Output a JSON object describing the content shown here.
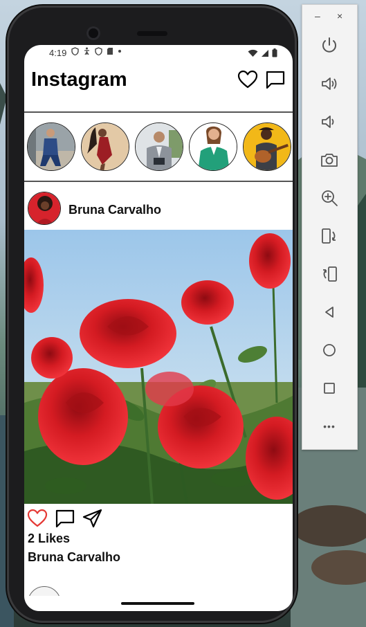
{
  "status_bar": {
    "time": "4:19"
  },
  "app": {
    "title": "Instagram"
  },
  "stories": [
    {
      "name": "story-1"
    },
    {
      "name": "story-2"
    },
    {
      "name": "story-3"
    },
    {
      "name": "story-4"
    },
    {
      "name": "story-5"
    }
  ],
  "post": {
    "username": "Bruna Carvalho",
    "likes": "2 Likes",
    "caption_user": "Bruna Carvalho"
  },
  "emulator": {
    "minimize": "–",
    "close": "×",
    "more": "•••"
  },
  "colors": {
    "like_accent": "#e53935",
    "rose_red": "#d0161f",
    "sky": "#a9cce8",
    "leaf": "#3b6b2c"
  }
}
